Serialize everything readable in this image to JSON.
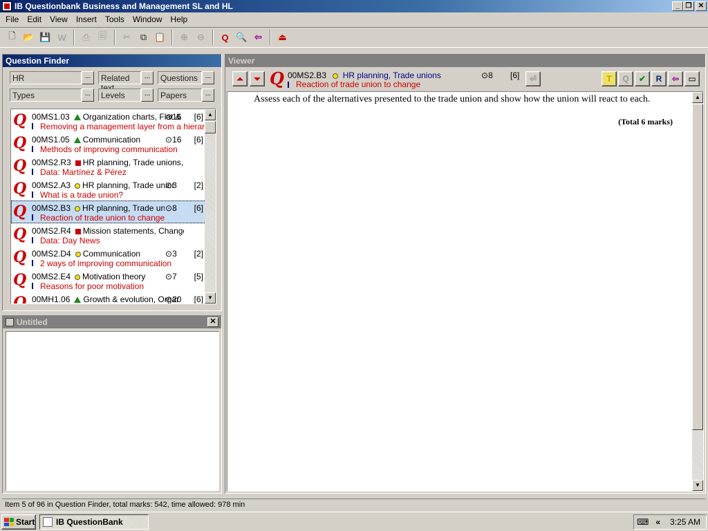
{
  "window": {
    "title": "IB Questionbank Business and Management SL and HL"
  },
  "menu": [
    "File",
    "Edit",
    "View",
    "Insert",
    "Tools",
    "Window",
    "Help"
  ],
  "finder": {
    "title": "Question Finder",
    "filters": {
      "topic": "HR",
      "related": "Related text",
      "questions": "Questions",
      "types": "Types",
      "levels": "Levels",
      "papers": "Papers"
    },
    "items": [
      {
        "code": "00MS1.03",
        "marker": "triangle",
        "topics": "Organization charts, Flat &",
        "time": "16",
        "marks": "[6]",
        "subtitle": "Removing a management layer from a hierarchy",
        "selected": false
      },
      {
        "code": "00MS1.05",
        "marker": "triangle",
        "topics": "Communication",
        "time": "16",
        "marks": "[6]",
        "subtitle": "Methods of improving communication",
        "selected": false
      },
      {
        "code": "00MS2.R3",
        "marker": "square",
        "topics": "HR planning, Trade unions, Working c",
        "time": "",
        "marks": "",
        "subtitle": "Data: Martínez & Pérez",
        "selected": false
      },
      {
        "code": "00MS2.A3",
        "marker": "circle",
        "topics": "HR planning, Trade unior",
        "time": "3",
        "marks": "[2]",
        "subtitle": "What is a trade union?",
        "selected": false
      },
      {
        "code": "00MS2.B3",
        "marker": "circle",
        "topics": "HR planning, Trade unior",
        "time": "8",
        "marks": "[6]",
        "subtitle": "Reaction of trade union to change",
        "selected": true
      },
      {
        "code": "00MS2.R4",
        "marker": "square",
        "topics": "Mission statements, Change managem",
        "time": "",
        "marks": "",
        "subtitle": "Data: Day News",
        "selected": false
      },
      {
        "code": "00MS2.D4",
        "marker": "circle",
        "topics": "Communication",
        "time": "3",
        "marks": "[2]",
        "subtitle": "2 ways of improving communication",
        "selected": false
      },
      {
        "code": "00MS2.E4",
        "marker": "circle",
        "topics": "Motivation theory",
        "time": "7",
        "marks": "[5]",
        "subtitle": "Reasons for poor motivation",
        "selected": false
      },
      {
        "code": "00MH1.06",
        "marker": "triangle",
        "topics": "Growth & evolution, Orgar",
        "time": "20",
        "marks": "[6]",
        "subtitle": "",
        "selected": false
      }
    ]
  },
  "untitled": {
    "title": "Untitled"
  },
  "viewer": {
    "title": "Viewer",
    "code": "00MS2.B3",
    "topics": "HR planning, Trade unions",
    "subtitle": "Reaction of trade union to change",
    "time": "8",
    "marks": "[6]",
    "question": "Assess each of the alternatives presented to the trade union and show how the union will react to each.",
    "total": "(Total 6 marks)"
  },
  "status": "Item 5 of 96 in Question Finder, total marks: 542, time allowed: 978 min",
  "taskbar": {
    "start": "Start",
    "app": "IB QuestionBank",
    "clock": "3:25 AM"
  },
  "colors": {
    "titlebar": "#0a246a",
    "accent_red": "#cc0000",
    "selection": "#c6dcf3"
  }
}
